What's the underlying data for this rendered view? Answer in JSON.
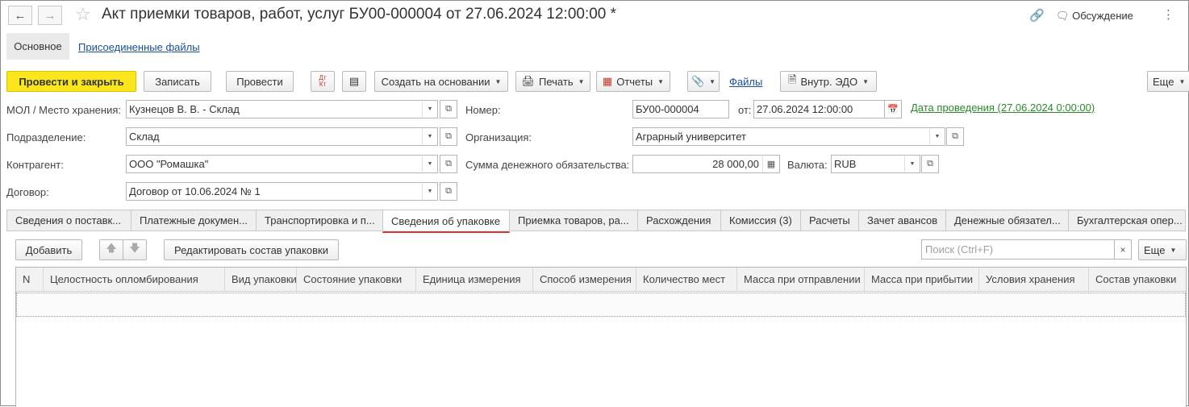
{
  "window": {
    "title": "Акт приемки товаров, работ, услуг БУ00-000004 от 27.06.2024 12:00:00 *",
    "discussion_label": "Обсуждение"
  },
  "sections": {
    "main_label": "Основное",
    "attached_files_label": "Присоединенные файлы"
  },
  "toolbar": {
    "post_close": "Провести и закрыть",
    "save": "Записать",
    "post": "Провести",
    "dt_kt": "Дт Кт",
    "create_based": "Создать на основании",
    "print": "Печать",
    "reports": "Отчеты",
    "files": "Файлы",
    "edo": "Внутр. ЭДО",
    "more": "Еще"
  },
  "form": {
    "mol_label": "МОЛ / Место хранения:",
    "mol_value": "Кузнецов В. В. - Склад",
    "dept_label": "Подразделение:",
    "dept_value": "Склад",
    "counterparty_label": "Контрагент:",
    "counterparty_value": "ООО \"Ромашка\"",
    "contract_label": "Договор:",
    "contract_value": "Договор от 10.06.2024 № 1",
    "number_label": "Номер:",
    "number_value": "БУ00-000004",
    "from_label": "от:",
    "date_value": "27.06.2024 12:00:00",
    "posting_date_link": "Дата проведения (27.06.2024 0:00:00)",
    "org_label": "Организация:",
    "org_value": "Аграрный университет",
    "amount_label": "Сумма денежного обязательства:",
    "amount_value": "28 000,00",
    "currency_label": "Валюта:",
    "currency_value": "RUB"
  },
  "tabs": [
    {
      "label": "Сведения о поставк..."
    },
    {
      "label": "Платежные докумен..."
    },
    {
      "label": "Транспортировка и п..."
    },
    {
      "label": "Сведения об упаковке"
    },
    {
      "label": "Приемка товаров, ра..."
    },
    {
      "label": "Расхождения"
    },
    {
      "label": "Комиссия (3)"
    },
    {
      "label": "Расчеты"
    },
    {
      "label": "Зачет авансов"
    },
    {
      "label": "Денежные обязател..."
    },
    {
      "label": "Бухгалтерская опер..."
    }
  ],
  "table_toolbar": {
    "add": "Добавить",
    "edit_packaging": "Редактировать состав упаковки",
    "search_placeholder": "Поиск (Ctrl+F)",
    "more": "Еще"
  },
  "table": {
    "columns": [
      "N",
      "Целостность опломбирования",
      "Вид упаковки",
      "Состояние упаковки",
      "Единица измерения",
      "Способ измерения",
      "Количество мест",
      "Масса при отправлении",
      "Масса при прибытии",
      "Условия хранения",
      "Состав упаковки"
    ],
    "rows": []
  },
  "colors": {
    "primary_button": "#fbe61e",
    "link": "#1a4fa0",
    "posting_link": "#2a8a2a",
    "active_tab_underline": "#d9302c"
  }
}
